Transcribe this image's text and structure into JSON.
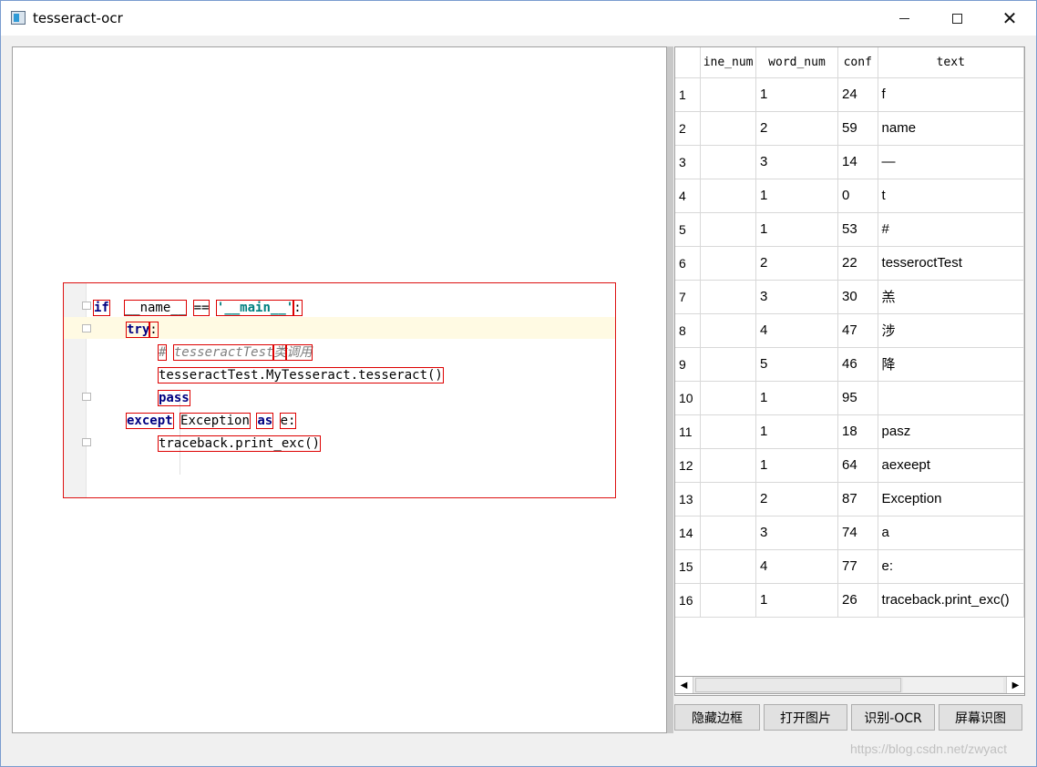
{
  "window": {
    "title": "tesseract-ocr"
  },
  "code_image": {
    "lines": [
      {
        "parts": [
          [
            "kw",
            "if"
          ],
          [
            "",
            "  "
          ],
          [
            "",
            "__name__"
          ],
          [
            "",
            " "
          ],
          [
            "",
            "=="
          ],
          [
            "",
            " "
          ],
          [
            "str",
            "'__main__'"
          ],
          [
            "",
            ":"
          ]
        ]
      },
      {
        "parts": [
          [
            "kw",
            "try"
          ],
          [
            "",
            ":"
          ]
        ]
      },
      {
        "parts": [
          [
            "cmt",
            "#"
          ],
          [
            "",
            " "
          ],
          [
            "cmt",
            "tesseractTest"
          ],
          [
            "cmt",
            "类"
          ],
          [
            "cmt",
            "调用"
          ]
        ]
      },
      {
        "parts": [
          [
            "",
            "tesseractTest.MyTesseract.tesseract()"
          ]
        ]
      },
      {
        "parts": [
          [
            "kw",
            "pass"
          ]
        ]
      },
      {
        "parts": [
          [
            "kw",
            "except"
          ],
          [
            "",
            " "
          ],
          [
            "",
            "Exception"
          ],
          [
            "",
            " "
          ],
          [
            "kw",
            "as"
          ],
          [
            "",
            " "
          ],
          [
            "",
            "e:"
          ]
        ]
      },
      {
        "parts": [
          [
            "",
            "traceback.print_exc()"
          ]
        ]
      }
    ]
  },
  "table": {
    "headers": [
      "ine_num",
      "word_num",
      "conf",
      "text"
    ],
    "rows": [
      [
        "1",
        "",
        "1",
        "24",
        "f"
      ],
      [
        "2",
        "",
        "2",
        "59",
        "name"
      ],
      [
        "3",
        "",
        "3",
        "14",
        "—"
      ],
      [
        "4",
        "",
        "1",
        "0",
        "t"
      ],
      [
        "5",
        "",
        "1",
        "53",
        "#"
      ],
      [
        "6",
        "",
        "2",
        "22",
        "tesseroctTest"
      ],
      [
        "7",
        "",
        "3",
        "30",
        "羔"
      ],
      [
        "8",
        "",
        "4",
        "47",
        "涉"
      ],
      [
        "9",
        "",
        "5",
        "46",
        "降"
      ],
      [
        "10",
        "",
        "1",
        "95",
        ""
      ],
      [
        "11",
        "",
        "1",
        "18",
        "pasz"
      ],
      [
        "12",
        "",
        "1",
        "64",
        "aexeept"
      ],
      [
        "13",
        "",
        "2",
        "87",
        "Exception"
      ],
      [
        "14",
        "",
        "3",
        "74",
        "a"
      ],
      [
        "15",
        "",
        "4",
        "77",
        "e:"
      ],
      [
        "16",
        "",
        "1",
        "26",
        "traceback.print_exc()"
      ]
    ]
  },
  "buttons": {
    "hide_border": "隐藏边框",
    "open_image": "打开图片",
    "recognize_ocr": "识别-OCR",
    "screen_recognize": "屏幕识图"
  },
  "watermark": "https://blog.csdn.net/zwyact"
}
